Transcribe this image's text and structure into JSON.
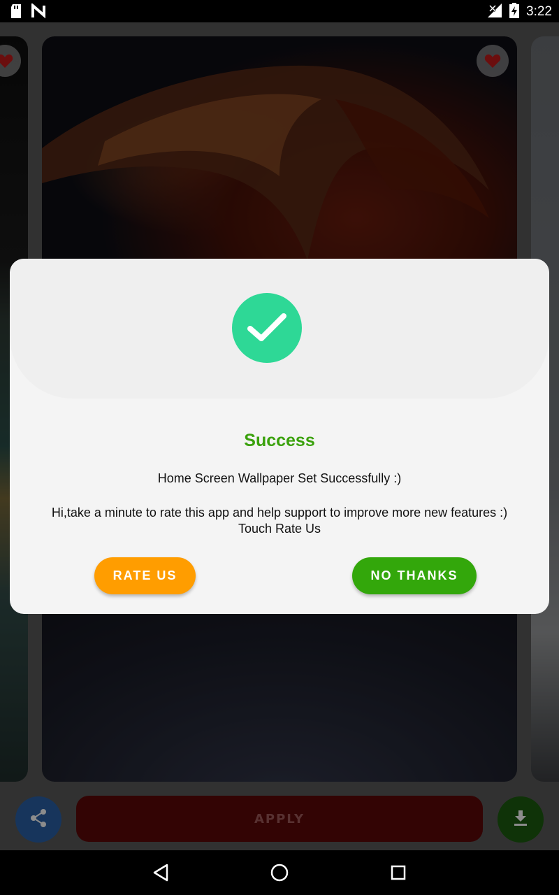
{
  "status_bar": {
    "time": "3:22",
    "left_icons": [
      "sd-card-icon",
      "n-notification-icon"
    ],
    "right_icons": [
      "no-signal-icon",
      "battery-charging-icon"
    ]
  },
  "bottom_controls": {
    "apply_label": "APPLY",
    "share_icon": "share-icon",
    "download_icon": "download-icon"
  },
  "dialog": {
    "title": "Success",
    "message": "Home Screen Wallpaper Set Successfully :)",
    "body_line1": "Hi,take a minute to rate this app and help support to improve more new features :)",
    "body_line2": "Touch Rate Us",
    "rate_button": "RATE US",
    "no_thanks_button": "NO THANKS",
    "colors": {
      "success_green": "#3aa10c",
      "check_circle": "#2ed896",
      "rate_orange": "#ff9d00",
      "no_thanks_green": "#33a70b"
    }
  },
  "nav_bar": {
    "icons": [
      "back-icon",
      "home-icon",
      "recents-icon"
    ]
  }
}
